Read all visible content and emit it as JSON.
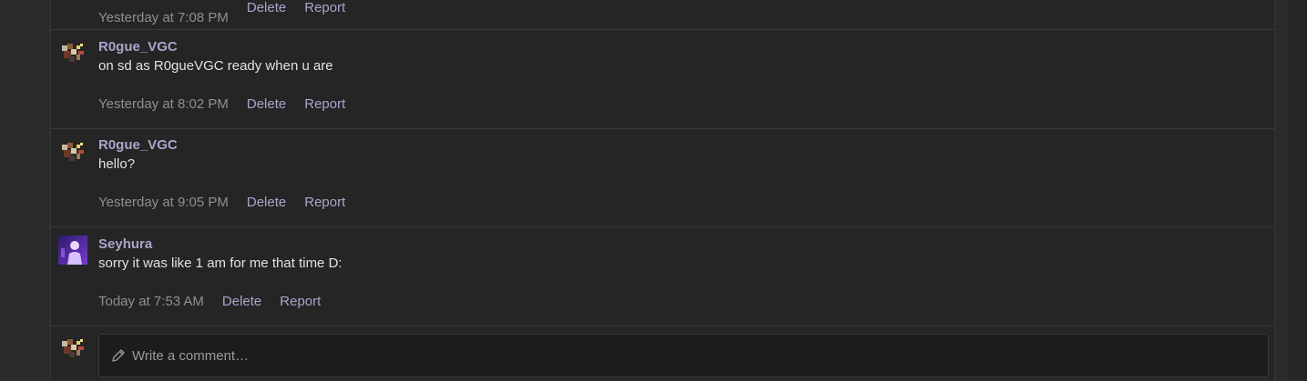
{
  "top_comment": {
    "time": "Yesterday at 7:08 PM",
    "delete_label": "Delete",
    "report_label": "Report"
  },
  "comments": [
    {
      "author": "R0gue_VGC",
      "text": "on sd as R0gueVGC ready when u are",
      "time": "Yesterday at 8:02 PM",
      "delete_label": "Delete",
      "report_label": "Report",
      "avatar": "pixel-sprite-avatar"
    },
    {
      "author": "R0gue_VGC",
      "text": "hello?",
      "time": "Yesterday at 9:05 PM",
      "delete_label": "Delete",
      "report_label": "Report",
      "avatar": "pixel-sprite-avatar"
    },
    {
      "author": "Seyhura",
      "text": "sorry it was like 1 am for me that time D:",
      "time": "Today at 7:53 AM",
      "delete_label": "Delete",
      "report_label": "Report",
      "avatar": "purple-figure-avatar"
    }
  ],
  "reply": {
    "placeholder": "Write a comment…",
    "icon": "pencil-icon",
    "avatar": "pixel-sprite-avatar"
  },
  "colors": {
    "link": "#a9a5cc",
    "muted": "#8f8f8f",
    "text": "#e2e2e2",
    "panel": "#252525"
  }
}
